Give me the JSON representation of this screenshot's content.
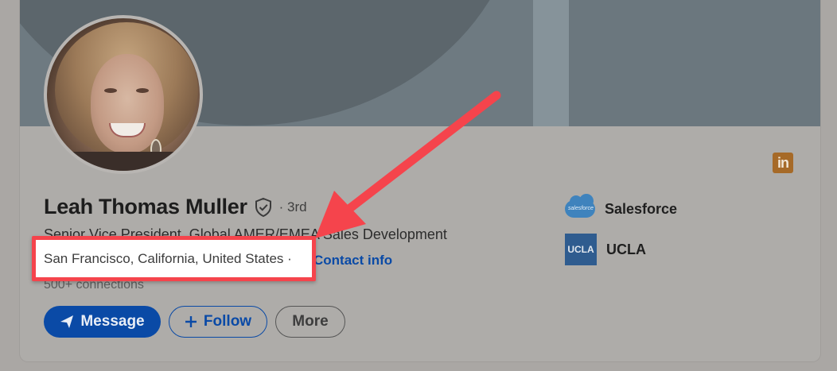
{
  "profile": {
    "name": "Leah Thomas Muller",
    "degree": "· 3rd",
    "headline": "Senior Vice President, Global AMER/EMEA Sales Development",
    "location": "San Francisco, California, United States ·",
    "contact_info": "Contact info",
    "connections": "500+ connections"
  },
  "actions": {
    "message": "Message",
    "follow": "Follow",
    "more": "More"
  },
  "companies": [
    {
      "name": "Salesforce",
      "logo_text": "salesforce"
    },
    {
      "name": "UCLA",
      "logo_text": "UCLA"
    }
  ],
  "linkedin_logo": "in",
  "colors": {
    "highlight_border": "#f5444c",
    "arrow": "#f5444c",
    "link_blue": "#0a4aa6"
  },
  "icons": [
    "verified-shield-icon",
    "send-icon",
    "plus-icon",
    "linkedin-icon",
    "annotation-arrow"
  ]
}
